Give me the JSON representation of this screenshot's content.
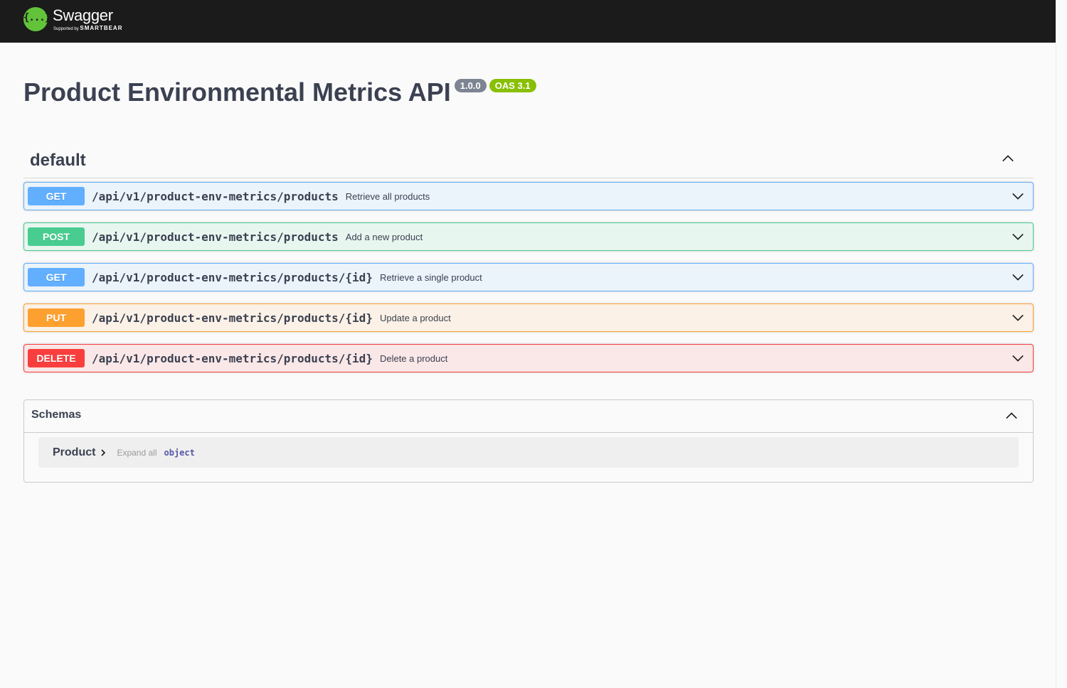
{
  "header": {
    "brand_name": "Swagger",
    "brand_sub_prefix": "Supported by",
    "brand_sub_company": "SMARTBEAR",
    "logo_glyph": "{...}",
    "background": "#1b1b1b",
    "logo_color": "#62c33a"
  },
  "info": {
    "title": "Product Environmental Metrics API",
    "version": "1.0.0",
    "oas": "OAS 3.1"
  },
  "tag": {
    "name": "default",
    "collapse_icon": "chevron-up-icon"
  },
  "operations": [
    {
      "method": "GET",
      "path": "/api/v1/product-env-metrics/products",
      "summary": "Retrieve all products",
      "color": "#61affe"
    },
    {
      "method": "POST",
      "path": "/api/v1/product-env-metrics/products",
      "summary": "Add a new product",
      "color": "#49cc90"
    },
    {
      "method": "GET",
      "path": "/api/v1/product-env-metrics/products/{id}",
      "summary": "Retrieve a single product",
      "color": "#61affe"
    },
    {
      "method": "PUT",
      "path": "/api/v1/product-env-metrics/products/{id}",
      "summary": "Update a product",
      "color": "#fca130"
    },
    {
      "method": "DELETE",
      "path": "/api/v1/product-env-metrics/products/{id}",
      "summary": "Delete a product",
      "color": "#f93e3e"
    }
  ],
  "schemas": {
    "title": "Schemas",
    "models": [
      {
        "name": "Product",
        "expand_label": "Expand all",
        "type": "object"
      }
    ]
  }
}
